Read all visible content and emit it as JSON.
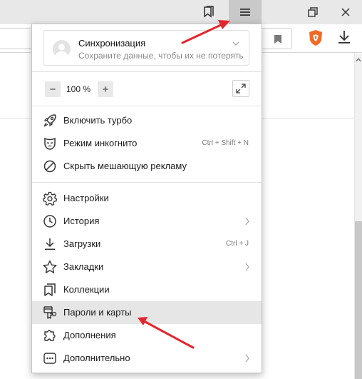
{
  "titlebar": {
    "buttons": [
      "bookmarks-panel",
      "main-menu",
      "restore",
      "close"
    ]
  },
  "sync": {
    "title": "Синхронизация",
    "subtitle": "Сохраните данные, чтобы их не потерять"
  },
  "zoom": {
    "minus": "−",
    "value": "100 %",
    "plus": "+"
  },
  "menu_items": [
    {
      "label": "Включить турбо",
      "icon": "rocket-icon"
    },
    {
      "label": "Режим инкогнито",
      "icon": "mask-icon",
      "shortcut": "Ctrl + Shift + N"
    },
    {
      "label": "Скрыть мешающую рекламу",
      "icon": "block-icon"
    },
    {
      "label": "Настройки",
      "icon": "gear-icon"
    },
    {
      "label": "История",
      "icon": "clock-icon",
      "submenu": true
    },
    {
      "label": "Загрузки",
      "icon": "download-icon",
      "shortcut": "Ctrl + J"
    },
    {
      "label": "Закладки",
      "icon": "star-icon",
      "submenu": true
    },
    {
      "label": "Коллекции",
      "icon": "collections-icon"
    },
    {
      "label": "Пароли и карты",
      "icon": "key-card-icon",
      "highlighted": true
    },
    {
      "label": "Дополнения",
      "icon": "puzzle-icon"
    },
    {
      "label": "Дополнительно",
      "icon": "more-icon",
      "submenu": true
    }
  ],
  "colors": {
    "annotation_arrow": "#e3262c",
    "highlight": "#e6e6e6",
    "titlebar": "#e8e8e8"
  }
}
